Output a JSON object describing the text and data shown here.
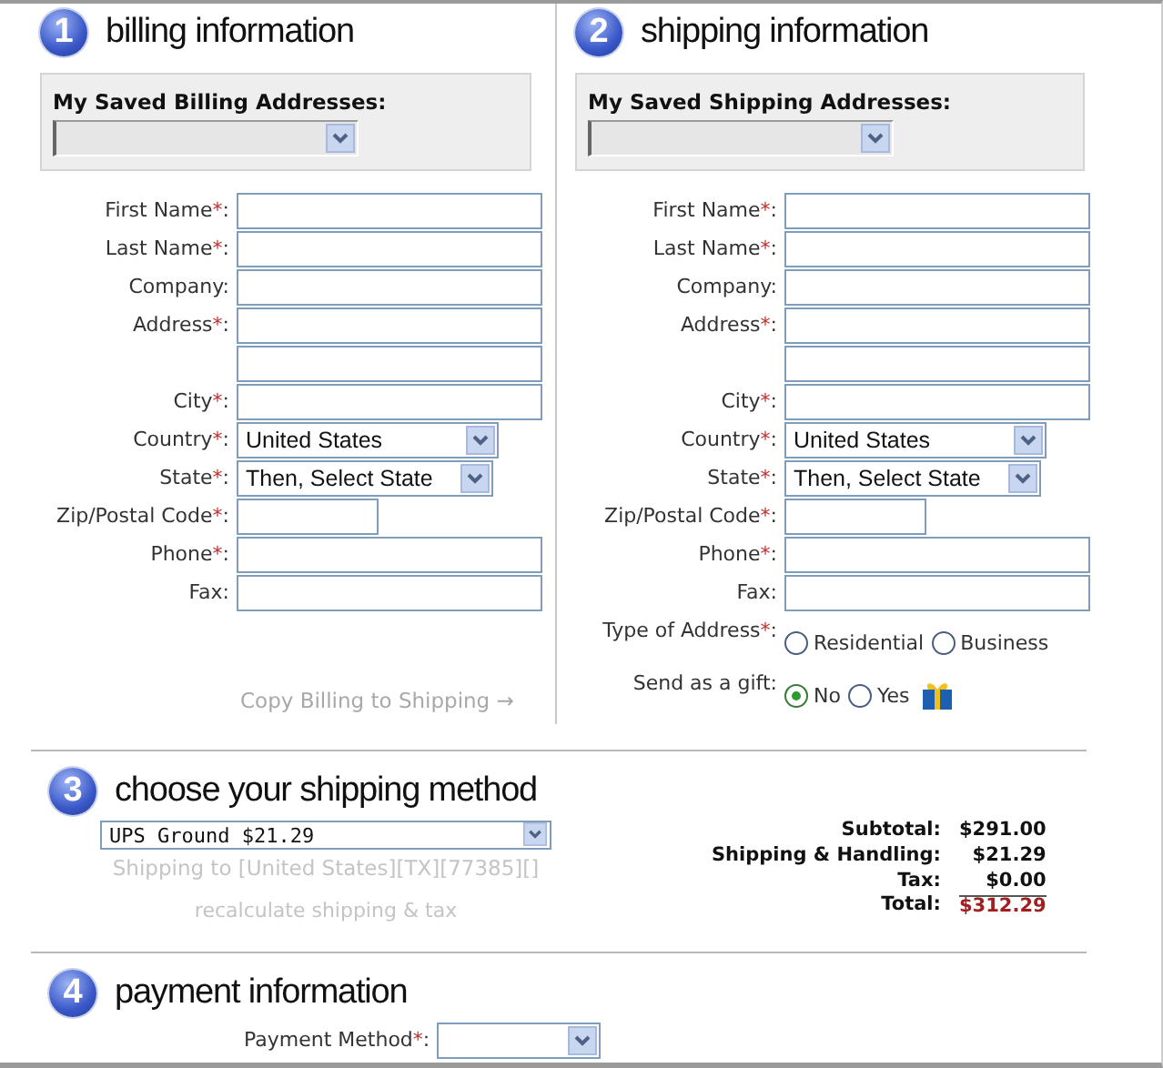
{
  "billing": {
    "number": "1",
    "title": "billing information",
    "saved_label": "My Saved Billing Addresses:",
    "fields": [
      {
        "kind": "text",
        "label": "First Name",
        "mark": "*",
        "colon": ":"
      },
      {
        "kind": "text",
        "label": "Last Name",
        "mark": "*",
        "colon": ":"
      },
      {
        "kind": "text",
        "label": "Company",
        "colon": ":"
      },
      {
        "kind": "text",
        "label": "Address",
        "mark": "*",
        "colon": ":"
      },
      {
        "kind": "text"
      },
      {
        "kind": "text",
        "label": "City",
        "mark": "*",
        "colon": ":"
      },
      {
        "kind": "select",
        "label": "Country",
        "mark": "*",
        "colon": ":",
        "value": "United States"
      },
      {
        "kind": "select-short",
        "label": "State",
        "mark": "*",
        "colon": ":",
        "value": "Then, Select State"
      },
      {
        "kind": "short",
        "label": "Zip/Postal Code",
        "mark": "*",
        "colon": ":"
      },
      {
        "kind": "text",
        "label": "Phone",
        "mark": "*",
        "colon": ":"
      },
      {
        "kind": "text",
        "label": "Fax",
        "colon": ":"
      }
    ],
    "copy_link": "Copy Billing to Shipping →"
  },
  "shipping": {
    "number": "2",
    "title": "shipping information",
    "saved_label": "My Saved Shipping Addresses:",
    "fields": [
      {
        "kind": "text",
        "label": "First Name",
        "mark": "*",
        "colon": ":"
      },
      {
        "kind": "text",
        "label": "Last Name",
        "mark": "*",
        "colon": ":"
      },
      {
        "kind": "text",
        "label": "Company",
        "colon": ":"
      },
      {
        "kind": "text",
        "label": "Address",
        "mark": "*",
        "colon": ":"
      },
      {
        "kind": "text"
      },
      {
        "kind": "text",
        "label": "City",
        "mark": "*",
        "colon": ":"
      },
      {
        "kind": "select",
        "label": "Country",
        "mark": "*",
        "colon": ":",
        "value": "United States"
      },
      {
        "kind": "select-short",
        "label": "State",
        "mark": "*",
        "colon": ":",
        "value": "Then, Select State"
      },
      {
        "kind": "short",
        "label": "Zip/Postal Code",
        "mark": "*",
        "colon": ":"
      },
      {
        "kind": "text",
        "label": "Phone",
        "mark": "*",
        "colon": ":"
      },
      {
        "kind": "text",
        "label": "Fax",
        "colon": ":"
      },
      {
        "kind": "radio",
        "label": "Type of Address",
        "mark": "*",
        "colon": ":",
        "options": [
          {
            "label": "Residential",
            "selected": false
          },
          {
            "label": "Business",
            "selected": false
          }
        ]
      },
      {
        "kind": "gift",
        "label": "Send as a gift",
        "colon": ":",
        "options": [
          {
            "label": "No",
            "selected": true
          },
          {
            "label": "Yes",
            "selected": false
          }
        ]
      }
    ]
  },
  "shipping_method": {
    "number": "3",
    "title": "choose your shipping method",
    "method": "UPS Ground $21.29",
    "shipping_to": "Shipping to [United States][TX][77385][]",
    "recalculate": "recalculate shipping & tax",
    "totals": [
      {
        "kind": "line",
        "label": "Subtotal:",
        "value": "$291.00"
      },
      {
        "kind": "line",
        "label": "Shipping & Handling:",
        "value": "$21.29"
      },
      {
        "kind": "line",
        "label": "Tax:",
        "value": "$0.00"
      },
      {
        "kind": "total",
        "label": "Total:",
        "value": "$312.29"
      }
    ]
  },
  "payment": {
    "number": "4",
    "title": "payment information",
    "method_label": "Payment Method",
    "mark": "*",
    "colon": ":"
  }
}
